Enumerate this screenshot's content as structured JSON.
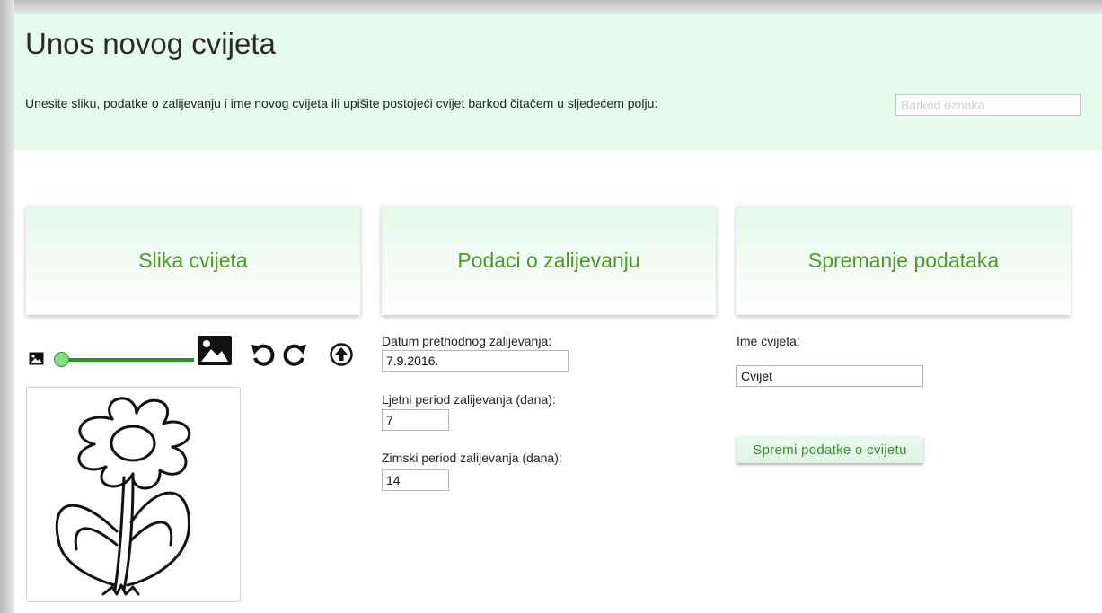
{
  "header": {
    "title": "Unos novog cvijeta",
    "instruction": "Unesite sliku, podatke o zalijevanju i ime novog cvijeta ili upišite postojeći cvijet barkod čitačem u sljedećem polju:",
    "barcode_placeholder": "Barkod oznaka",
    "barcode_value": ""
  },
  "cards": {
    "image": "Slika cvijeta",
    "watering": "Podaci o zalijevanju",
    "saving": "Spremanje podataka"
  },
  "image_tools": {
    "zoom_level": 0,
    "icons": [
      "small-image-icon",
      "large-image-icon",
      "rotate-left-icon",
      "rotate-right-icon",
      "upload-icon"
    ]
  },
  "watering": {
    "last_date_label": "Datum prethodnog zalijevanja:",
    "last_date_value": "7.9.2016.",
    "summer_label": "Ljetni period zalijevanja (dana):",
    "summer_value": "7",
    "winter_label": "Zimski period zalijevanja (dana):",
    "winter_value": "14"
  },
  "save": {
    "name_label": "Ime cvijeta:",
    "name_value": "Cvijet",
    "button_label": "Spremi podatke o cvijetu"
  },
  "colors": {
    "header_bg": "#e6fbea",
    "accent_green": "#4b9a2a",
    "slider_green": "#1f9a1f"
  }
}
